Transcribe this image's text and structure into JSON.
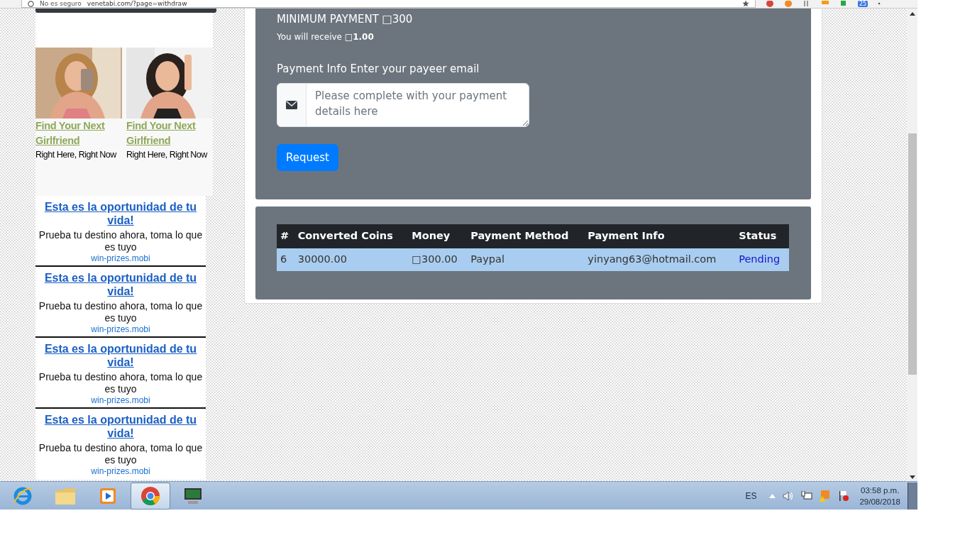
{
  "browser": {
    "security": "No es seguro",
    "url": "venetabi.com/?page=withdraw",
    "extension_badge": "25"
  },
  "ads": {
    "cards": [
      {
        "title": "Find Your Next Girlfriend",
        "subtitle": "Right Here, Right Now"
      },
      {
        "title": "Find Your Next Girlfriend",
        "subtitle": "Right Here, Right Now"
      }
    ],
    "promos": [
      {
        "title": "Esta es la oportunidad de tu vida!",
        "text": "Prueba tu destino ahora, toma lo que es tuyo",
        "domain": "win-prizes.mobi"
      },
      {
        "title": "Esta es la oportunidad de tu vida!",
        "text": "Prueba tu destino ahora, toma lo que es tuyo",
        "domain": "win-prizes.mobi"
      },
      {
        "title": "Esta es la oportunidad de tu vida!",
        "text": "Prueba tu destino ahora, toma lo que es tuyo",
        "domain": "win-prizes.mobi"
      },
      {
        "title": "Esta es la oportunidad de tu vida!",
        "text": "Prueba tu destino ahora, toma lo que es tuyo",
        "domain": "win-prizes.mobi"
      }
    ]
  },
  "withdraw": {
    "minimum": "MINIMUM PAYMENT □300",
    "receive": "You will receive **□1.00**",
    "field_label": "Payment Info Enter your payeer email",
    "placeholder": "Please complete with your payment details here",
    "button": "Request"
  },
  "table": {
    "columns": [
      "#",
      "Converted Coins",
      "Money",
      "Payment Method",
      "Payment Info",
      "Status"
    ],
    "rows": [
      {
        "cells": [
          "6",
          "30000.00",
          "□300.00",
          "Paypal",
          "yinyang63@hotmail.com"
        ],
        "status": "Pending"
      }
    ]
  },
  "taskbar": {
    "apps": [
      {
        "kind": "ie",
        "selected": false
      },
      {
        "kind": "folder",
        "selected": false
      },
      {
        "kind": "media",
        "selected": false
      },
      {
        "kind": "chrome",
        "selected": true
      },
      {
        "kind": "monitor",
        "selected": false
      }
    ],
    "language": "ES",
    "time": "03:58 p.m.",
    "date": "29/08/2018"
  }
}
